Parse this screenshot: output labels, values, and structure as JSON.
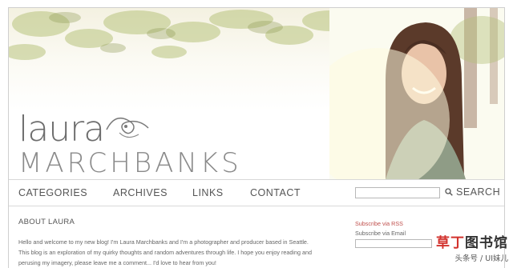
{
  "logo": {
    "line1": "laura",
    "line2": "MARCHBANKS"
  },
  "nav": {
    "items": [
      {
        "label": "CATEGORIES"
      },
      {
        "label": "ARCHIVES"
      },
      {
        "label": "LINKS"
      },
      {
        "label": "CONTACT"
      }
    ],
    "search_label": "SEARCH",
    "search_icon": "search-icon"
  },
  "main": {
    "heading": "ABOUT LAURA",
    "paragraph1": "Hello and welcome to my new blog! I'm Laura Marchbanks and I'm a photographer and producer based in Seattle.",
    "paragraph2": "This blog is an exploration of my quirky thoughts and random adventures through life. I hope you enjoy reading and",
    "paragraph3": "perusing my imagery, please leave me a comment... I'd love to hear from you!"
  },
  "sidebar": {
    "rss_label": "Subscribe via RSS",
    "email_label": "Subscribe via Email"
  },
  "watermark": {
    "chars": [
      "草",
      "丁",
      "图",
      "书",
      "馆"
    ],
    "sub": "头条号 / UI妹儿"
  },
  "colors": {
    "nav_text": "#555555",
    "rss_link": "#c0504d",
    "watermark_red": "#d2322d",
    "watermark_dark": "#333333"
  }
}
